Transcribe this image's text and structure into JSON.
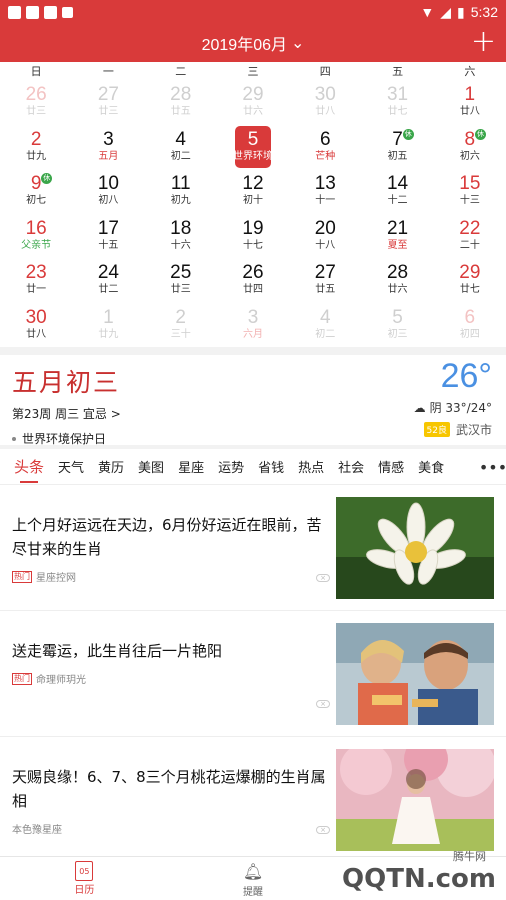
{
  "status_bar": {
    "time": "5:32"
  },
  "header": {
    "title": "2019年06月",
    "add_icon": "plus-icon"
  },
  "weekdays": [
    "日",
    "一",
    "二",
    "三",
    "四",
    "五",
    "六"
  ],
  "calendar": [
    {
      "day": "26",
      "lunar": "廿三",
      "style": "dim"
    },
    {
      "day": "27",
      "lunar": "廿三",
      "style": "dimgray"
    },
    {
      "day": "28",
      "lunar": "廿五",
      "style": "dimgray"
    },
    {
      "day": "29",
      "lunar": "廿六",
      "style": "dimgray"
    },
    {
      "day": "30",
      "lunar": "廿八",
      "style": "dimgray"
    },
    {
      "day": "31",
      "lunar": "廿七",
      "style": "dimgray"
    },
    {
      "day": "1",
      "lunar": "廿八",
      "style": "red"
    },
    {
      "day": "2",
      "lunar": "廿九",
      "style": "red"
    },
    {
      "day": "3",
      "lunar": "五月",
      "style": "normal",
      "lunar_style": "redtxt"
    },
    {
      "day": "4",
      "lunar": "初二",
      "style": "normal"
    },
    {
      "day": "5",
      "lunar": "世界环境",
      "style": "today"
    },
    {
      "day": "6",
      "lunar": "芒种",
      "style": "normal",
      "lunar_style": "redtxt"
    },
    {
      "day": "7",
      "lunar": "初五",
      "style": "normal",
      "badge": "休"
    },
    {
      "day": "8",
      "lunar": "初六",
      "style": "red",
      "badge": "休"
    },
    {
      "day": "9",
      "lunar": "初七",
      "style": "red",
      "badge": "休"
    },
    {
      "day": "10",
      "lunar": "初八",
      "style": "normal"
    },
    {
      "day": "11",
      "lunar": "初九",
      "style": "normal"
    },
    {
      "day": "12",
      "lunar": "初十",
      "style": "normal"
    },
    {
      "day": "13",
      "lunar": "十一",
      "style": "normal"
    },
    {
      "day": "14",
      "lunar": "十二",
      "style": "normal"
    },
    {
      "day": "15",
      "lunar": "十三",
      "style": "red"
    },
    {
      "day": "16",
      "lunar": "父亲节",
      "style": "red",
      "lunar_style": "greentxt"
    },
    {
      "day": "17",
      "lunar": "十五",
      "style": "normal"
    },
    {
      "day": "18",
      "lunar": "十六",
      "style": "normal"
    },
    {
      "day": "19",
      "lunar": "十七",
      "style": "normal"
    },
    {
      "day": "20",
      "lunar": "十八",
      "style": "normal"
    },
    {
      "day": "21",
      "lunar": "夏至",
      "style": "normal",
      "lunar_style": "redtxt"
    },
    {
      "day": "22",
      "lunar": "二十",
      "style": "red"
    },
    {
      "day": "23",
      "lunar": "廿一",
      "style": "red"
    },
    {
      "day": "24",
      "lunar": "廿二",
      "style": "normal"
    },
    {
      "day": "25",
      "lunar": "廿三",
      "style": "normal"
    },
    {
      "day": "26",
      "lunar": "廿四",
      "style": "normal"
    },
    {
      "day": "27",
      "lunar": "廿五",
      "style": "normal"
    },
    {
      "day": "28",
      "lunar": "廿六",
      "style": "normal"
    },
    {
      "day": "29",
      "lunar": "廿七",
      "style": "red"
    },
    {
      "day": "30",
      "lunar": "廿八",
      "style": "red"
    },
    {
      "day": "1",
      "lunar": "廿九",
      "style": "dimgray"
    },
    {
      "day": "2",
      "lunar": "三十",
      "style": "dimgray"
    },
    {
      "day": "3",
      "lunar": "六月",
      "style": "dimgray",
      "lunar_style": "pinktxt"
    },
    {
      "day": "4",
      "lunar": "初二",
      "style": "dimgray"
    },
    {
      "day": "5",
      "lunar": "初三",
      "style": "dimgray"
    },
    {
      "day": "6",
      "lunar": "初四",
      "style": "dim"
    }
  ],
  "day_card": {
    "lunar_date": "五月初三",
    "week_line": "第23周 周三 宜忌 >",
    "holiday": "世界环境保护日",
    "temperature": "26°",
    "weather": "阴 33°/24°",
    "aqi": "52良",
    "city": "武汉市"
  },
  "tabs": [
    "头条",
    "天气",
    "黄历",
    "美图",
    "星座",
    "运势",
    "省钱",
    "热点",
    "社会",
    "情感",
    "美食"
  ],
  "feed": [
    {
      "headline": "上个月好运远在天边，6月份好运近在眼前，苦尽甘来的生肖",
      "hot": "热门",
      "source": "星座控网"
    },
    {
      "headline": "送走霉运，此生肖往后一片艳阳",
      "hot": "热门",
      "source": "命理师玥光"
    },
    {
      "headline": "天赐良缘！6、7、8三个月桃花运爆棚的生肖属相",
      "hot": "",
      "source": "本色豫星座"
    }
  ],
  "bottom_nav": [
    {
      "label": "日历",
      "icon": "calendar-icon",
      "badge": "05"
    },
    {
      "label": "提醒",
      "icon": "bell-icon"
    }
  ],
  "watermark": {
    "text": "QQTN.com",
    "site": "腾牛网"
  }
}
